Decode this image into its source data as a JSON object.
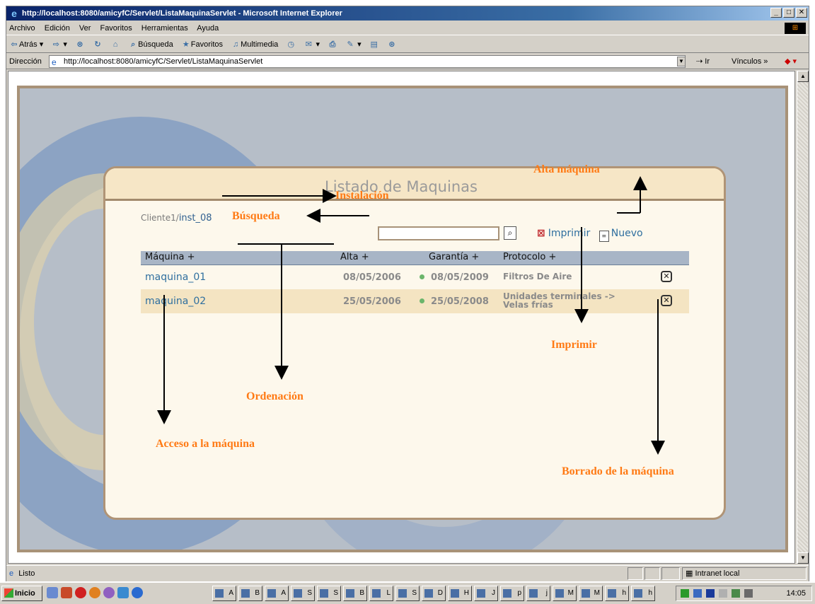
{
  "window": {
    "title": "http://localhost:8080/amicyfC/Servlet/ListaMaquinaServlet - Microsoft Internet Explorer",
    "controls": [
      "_",
      "□",
      "✕"
    ]
  },
  "menu": [
    "Archivo",
    "Edición",
    "Ver",
    "Favoritos",
    "Herramientas",
    "Ayuda"
  ],
  "toolbar": {
    "back": "Atrás",
    "search": "Búsqueda",
    "favorites": "Favoritos",
    "multimedia": "Multimedia"
  },
  "address": {
    "label": "Dirección",
    "url": "http://localhost:8080/amicyfC/Servlet/ListaMaquinaServlet",
    "go": "Ir",
    "links": "Vínculos"
  },
  "page": {
    "title": "Listado de Maquinas",
    "breadcrumb_client": "Cliente1/",
    "breadcrumb_inst": "inst_08",
    "search_value": "",
    "print_label": "Imprimir",
    "new_label": "Nuevo",
    "columns": {
      "machine": "Máquina +",
      "alta": "Alta +",
      "garantia": "Garantía +",
      "protocolo": "Protocolo +"
    },
    "rows": [
      {
        "name": "maquina_01",
        "alta": "08/05/2006",
        "garantia": "08/05/2009",
        "protocolo": "Filtros De Aire"
      },
      {
        "name": "maquina_02",
        "alta": "25/05/2006",
        "garantia": "25/05/2008",
        "protocolo": "Unidades terminales -> Velas frías"
      }
    ]
  },
  "annotations": {
    "alta": "Alta máquina",
    "instalacion": "Instalación",
    "busqueda": "Búsqueda",
    "imprimir": "Imprimir",
    "ordenacion": "Ordenación",
    "acceso": "Acceso a la máquina",
    "borrado": "Borrado de la máquina"
  },
  "status": {
    "text": "Listo",
    "zone": "Intranet local"
  },
  "taskbar": {
    "start": "Inicio",
    "clock": "14:05",
    "task_letters": [
      "A",
      "B",
      "A",
      "S",
      "S",
      "B",
      "L",
      "S",
      "D",
      "H",
      "J",
      "p",
      "j",
      "M",
      "M",
      "h",
      "h"
    ]
  },
  "colors": {
    "annotation": "#ff7a14",
    "link": "#2f6f9f",
    "panel_bg": "#fdf8ec",
    "header_bar": "#a8b5c6"
  }
}
